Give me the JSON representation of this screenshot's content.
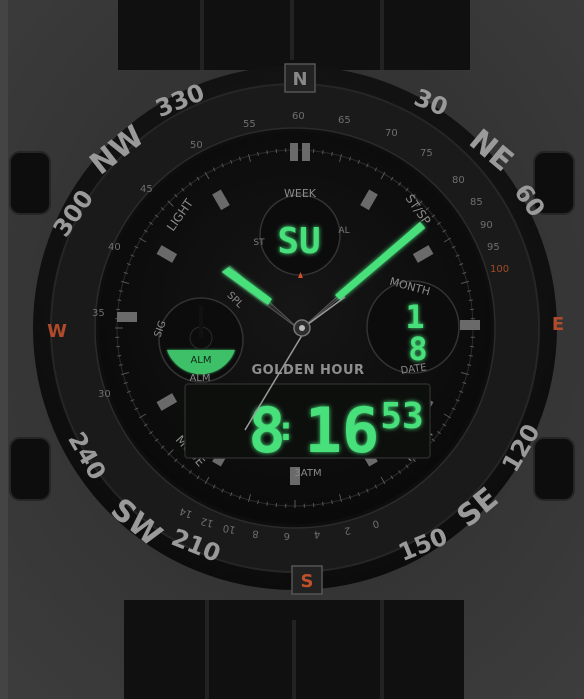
{
  "colors": {
    "lume": "#46e07a",
    "lcd_glow": "#39d46c",
    "bezel": "#1c1c1c",
    "metal": "#141414",
    "background": "#3b3b3b",
    "marker_orange": "#d0502a"
  },
  "bezel": {
    "north": "N",
    "south": "S",
    "east": "E",
    "west": "W",
    "labels": [
      "330",
      "NW",
      "300",
      "30",
      "NE",
      "60",
      "240",
      "SW",
      "210",
      "120",
      "SE",
      "150"
    ]
  },
  "dial": {
    "brand": "GOLDEN HOUR",
    "water_resistance": "3ATM",
    "button_labels": {
      "light": "LIGHT",
      "st_sp": "ST/SP",
      "mode": "MODE",
      "reset": "RESET"
    },
    "minute_numbers": [
      "55",
      "60",
      "65",
      "70",
      "75",
      "80",
      "85",
      "90",
      "95",
      "100",
      "50",
      "45",
      "40",
      "35",
      "30"
    ],
    "minute_numbers_bottom": [
      "14",
      "12",
      "10",
      "8",
      "6",
      "4",
      "2",
      "0"
    ]
  },
  "subdials": {
    "week": {
      "label": "WEEK",
      "value": "SU",
      "left_marker": "ST",
      "right_marker": "AL"
    },
    "month": {
      "label": "MONTH",
      "month_value": "1",
      "date_value": "8",
      "bottom_label": "DATE"
    },
    "alarm": {
      "left_label": "SIG",
      "right_label": "SPL",
      "indicator": "ALM",
      "bottom_label": "ALM"
    }
  },
  "lcd_display": {
    "hour": "8",
    "minutes": "16",
    "seconds": "53"
  }
}
